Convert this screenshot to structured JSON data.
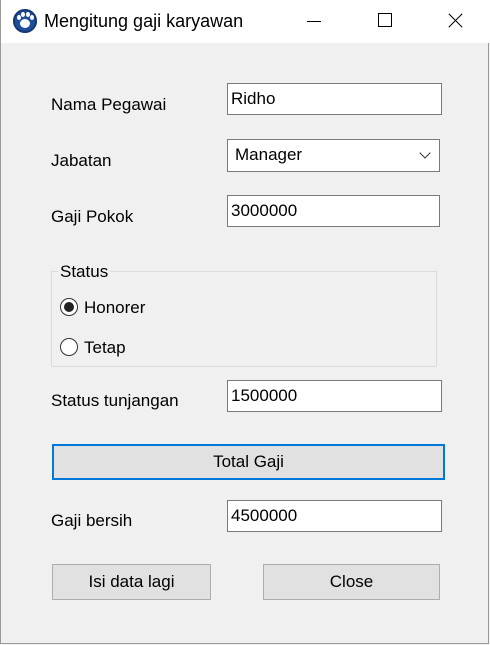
{
  "window": {
    "title": "Mengitung gaji karyawan"
  },
  "form": {
    "nama_label": "Nama Pegawai",
    "nama_value": "Ridho",
    "jabatan_label": "Jabatan",
    "jabatan_value": "Manager",
    "gaji_pokok_label": "Gaji Pokok",
    "gaji_pokok_value": "3000000",
    "status_group_title": "Status",
    "status_options": [
      {
        "label": "Honorer",
        "checked": true
      },
      {
        "label": "Tetap",
        "checked": false
      }
    ],
    "tunjangan_label": "Status tunjangan",
    "tunjangan_value": "1500000",
    "total_button": "Total Gaji",
    "gaji_bersih_label": "Gaji bersih",
    "gaji_bersih_value": "4500000",
    "isi_button": "Isi data lagi",
    "close_button": "Close"
  },
  "icons": {
    "app": "paw-icon",
    "minimize": "minimize-icon",
    "maximize": "maximize-icon",
    "close": "close-icon",
    "dropdown": "chevron-down-icon"
  },
  "colors": {
    "focus_border": "#0078d7",
    "button_bg": "#e1e1e1",
    "window_bg": "#f0f0f0"
  }
}
